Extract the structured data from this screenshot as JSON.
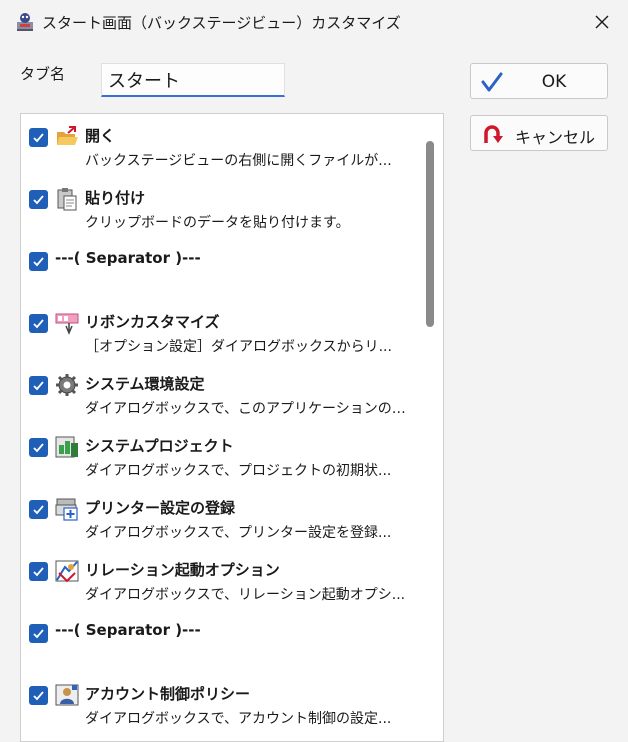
{
  "window": {
    "title": "スタート画面（バックステージビュー）カスタマイズ"
  },
  "form": {
    "tab_name_label": "タブ名",
    "tab_name_value": "スタート"
  },
  "buttons": {
    "ok_label": "OK",
    "cancel_label": "キャンセル"
  },
  "colors": {
    "accent": "#1f5fb8",
    "ok_check": "#2a62c8",
    "cancel_arrow": "#d0182c"
  },
  "items": [
    {
      "title": "開く",
      "desc": "バックステージビューの右側に開くファイルが...",
      "icon": "folder-open-icon"
    },
    {
      "title": "貼り付け",
      "desc": "クリップボードのデータを貼り付けます。",
      "icon": "paste-icon"
    },
    {
      "title": "---( Separator )---",
      "desc": "",
      "icon": ""
    },
    {
      "title": "リボンカスタマイズ",
      "desc": "［オプション設定］ダイアログボックスからリ...",
      "icon": "ribbon-customize-icon"
    },
    {
      "title": "システム環境設定",
      "desc": "ダイアログボックスで、このアプリケーションのシ...",
      "icon": "gear-icon"
    },
    {
      "title": "システムプロジェクト",
      "desc": "ダイアログボックスで、プロジェクトの初期状...",
      "icon": "system-project-icon"
    },
    {
      "title": "プリンター設定の登録",
      "desc": "ダイアログボックスで、プリンター設定を登録...",
      "icon": "printer-settings-icon"
    },
    {
      "title": "リレーション起動オプション",
      "desc": "ダイアログボックスで、リレーション起動オプシ...",
      "icon": "relation-option-icon"
    },
    {
      "title": "---( Separator )---",
      "desc": "",
      "icon": ""
    },
    {
      "title": "アカウント制御ポリシー",
      "desc": "ダイアログボックスで、アカウント制御の設定...",
      "icon": "account-policy-icon"
    }
  ]
}
